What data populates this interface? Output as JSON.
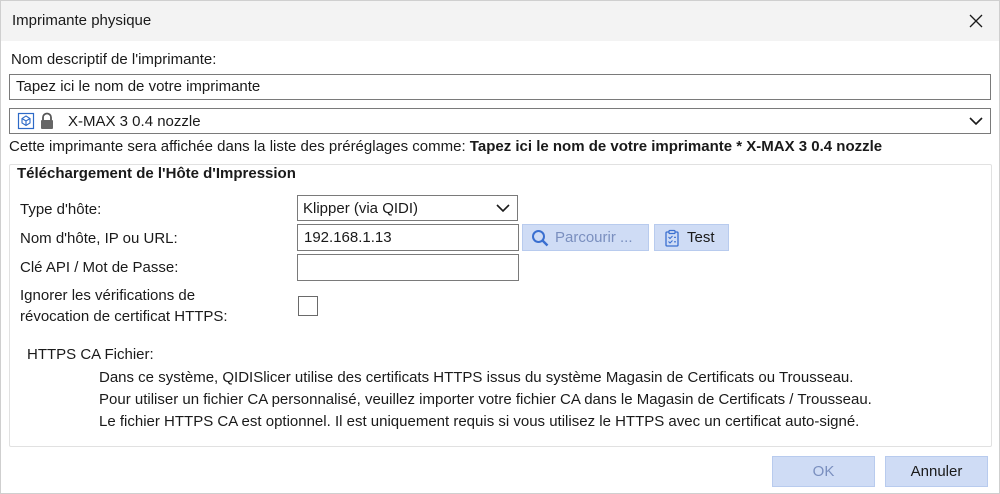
{
  "window": {
    "title": "Imprimante physique"
  },
  "printer": {
    "name_label": "Nom descriptif de l'imprimante:",
    "name_value": "Tapez ici le nom de votre imprimante",
    "preset_value": "X-MAX 3 0.4 nozzle",
    "preview_prefix": "Cette imprimante sera affichée dans la liste des préréglages comme:",
    "preview_value": "Tapez ici le nom de votre imprimante * X-MAX 3 0.4 nozzle"
  },
  "host": {
    "group_title": "Téléchargement de l'Hôte d'Impression",
    "type_label": "Type d'hôte:",
    "type_value": "Klipper (via QIDI)",
    "hostname_label": "Nom d'hôte, IP ou URL:",
    "hostname_value": "192.168.1.13",
    "browse_label": "Parcourir ...",
    "test_label": "Test",
    "api_label": "Clé API / Mot de Passe:",
    "api_value": "",
    "ignore_label_line1": "Ignorer les vérifications de",
    "ignore_label_line2": "révocation de certificat HTTPS:",
    "ca_label": "HTTPS CA Fichier:",
    "ca_info": [
      "Dans ce système, QIDISlicer utilise des certificats HTTPS issus du système Magasin de Certificats ou Trousseau.",
      "Pour utiliser un fichier CA personnalisé, veuillez importer votre fichier CA dans le Magasin de Certificats / Trousseau.",
      "Le fichier HTTPS CA est optionnel. Il est uniquement requis si vous utilisez le HTTPS avec un certificat auto-signé."
    ]
  },
  "footer": {
    "ok_label": "OK",
    "cancel_label": "Annuler"
  },
  "colors": {
    "accent_button": "#cfdcf5",
    "disabled_text": "#7a8fbf",
    "title_bar": "#f3f3f3"
  },
  "icons": [
    "close-icon",
    "printer-preset-icon",
    "lock-icon",
    "chevron-down-icon",
    "search-icon",
    "test-clipboard-icon"
  ]
}
